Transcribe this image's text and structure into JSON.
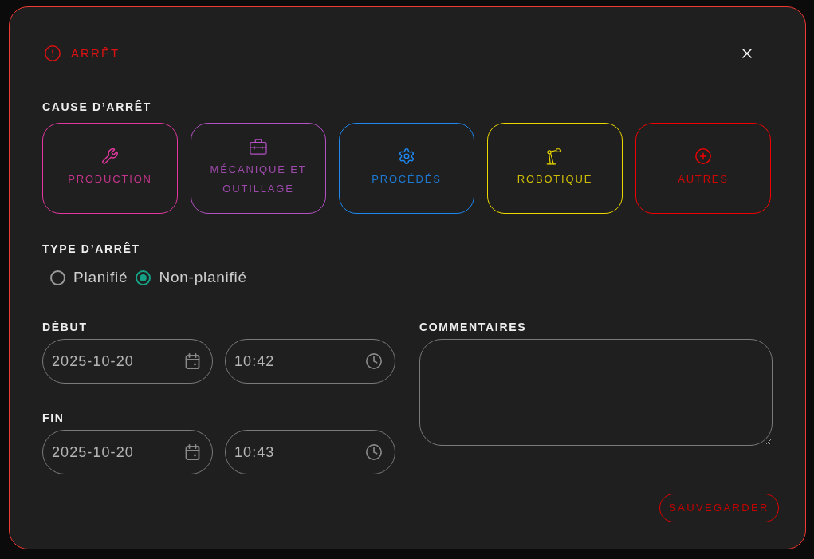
{
  "dialog": {
    "title": "ARRÊT"
  },
  "cause": {
    "label": "CAUSE D’ARRÊT",
    "options": [
      {
        "label": "PRODUCTION",
        "color": "#e0389e",
        "selected": false
      },
      {
        "label": "MÉCANIQUE ET OUTILLAGE",
        "color": "#b451c4",
        "selected": false
      },
      {
        "label": "PROCÉDÉS",
        "color": "#1e88f0",
        "selected": false
      },
      {
        "label": "ROBOTIQUE",
        "color": "#ecd800",
        "selected": false
      },
      {
        "label": "AUTRES",
        "color": "#f00000",
        "selected": false
      }
    ]
  },
  "stop_type": {
    "label": "TYPE D’ARRÊT",
    "options": [
      {
        "label": "Planifié",
        "selected": false
      },
      {
        "label": "Non-planifié",
        "selected": true
      }
    ]
  },
  "start": {
    "label": "DÉBUT",
    "date": "2025-10-20",
    "time": "10:42"
  },
  "end": {
    "label": "FIN",
    "date": "2025-10-20",
    "time": "10:43"
  },
  "comments": {
    "label": "COMMENTAIRES"
  },
  "save_button": "SAUVEGARDER"
}
